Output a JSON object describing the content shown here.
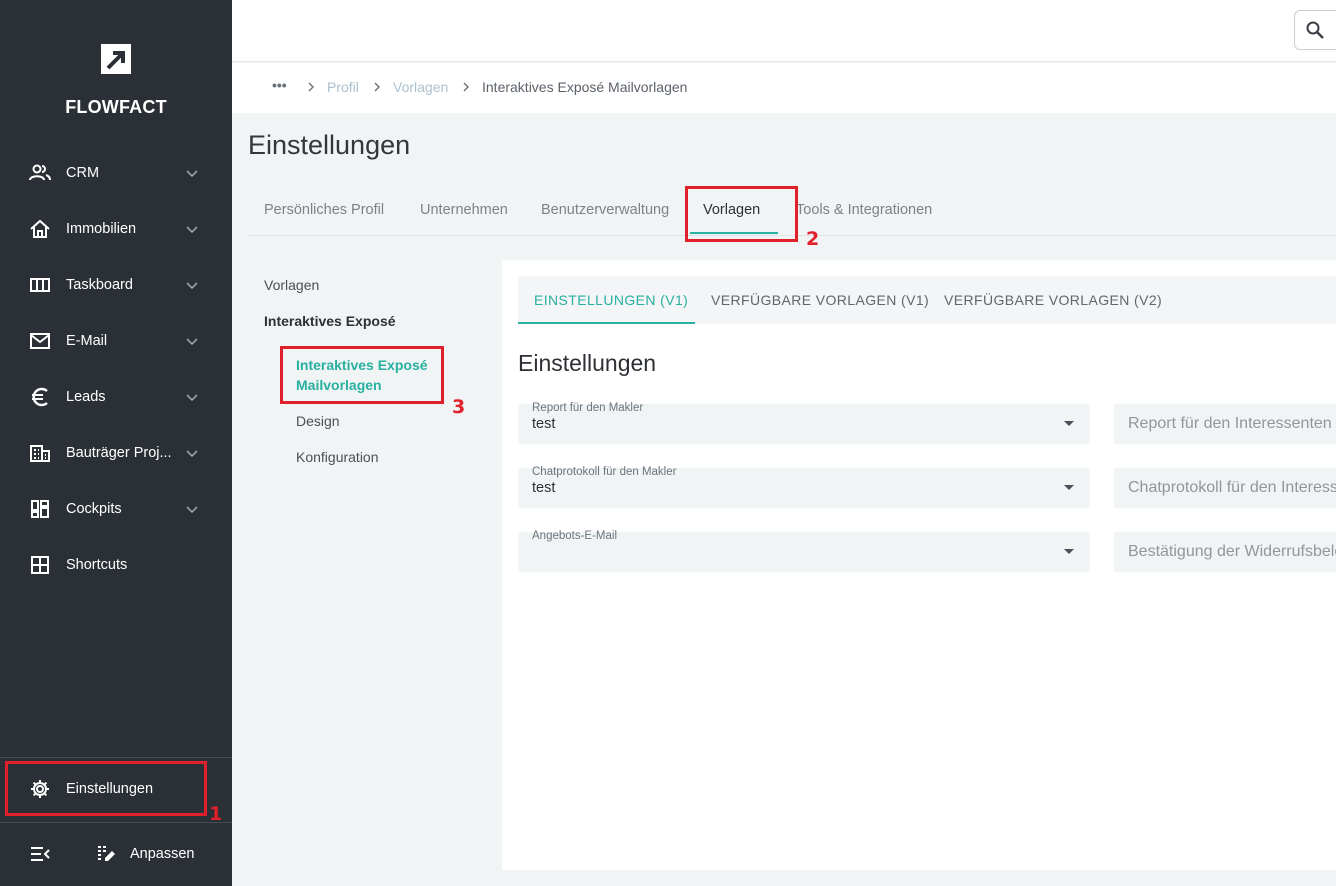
{
  "brand": {
    "name": "FLOWFACT"
  },
  "sidebar": {
    "items": [
      {
        "label": "CRM",
        "icon": "people-icon"
      },
      {
        "label": "Immobilien",
        "icon": "home-icon"
      },
      {
        "label": "Taskboard",
        "icon": "columns-icon"
      },
      {
        "label": "E-Mail",
        "icon": "mail-icon"
      },
      {
        "label": "Leads",
        "icon": "euro-icon"
      },
      {
        "label": "Bauträger Proj...",
        "icon": "building-icon"
      },
      {
        "label": "Cockpits",
        "icon": "dashboard-icon"
      },
      {
        "label": "Shortcuts",
        "icon": "grid-icon"
      }
    ],
    "settings_label": "Einstellungen",
    "customize_label": "Anpassen"
  },
  "breadcrumb": {
    "more": "•••",
    "items": [
      "Profil",
      "Vorlagen",
      "Interaktives Exposé Mailvorlagen"
    ]
  },
  "page": {
    "title": "Einstellungen",
    "tabs": [
      "Persönliches Profil",
      "Unternehmen",
      "Benutzerverwaltung",
      "Vorlagen",
      "Tools & Integrationen"
    ],
    "active_tab": "Vorlagen"
  },
  "subnav": {
    "items": [
      "Vorlagen",
      "Interaktives Exposé",
      "Interaktives Exposé",
      "Mailvorlagen",
      "Design",
      "Konfiguration"
    ]
  },
  "content": {
    "tabs": [
      "EINSTELLUNGEN (V1)",
      "VERFÜGBARE VORLAGEN (V1)",
      "VERFÜGBARE VORLAGEN (V2)"
    ],
    "section_title": "Einstellungen",
    "fields": [
      {
        "label": "Report für den Makler",
        "value": "test"
      },
      {
        "label": "Chatprotokoll für den Makler",
        "value": "test"
      },
      {
        "label": "Angebots-E-Mail",
        "value": ""
      }
    ],
    "right_fields": [
      "Report für den Interessenten",
      "Chatprotokoll für den Interessenten",
      "Bestätigung der Widerrufsbelehrung"
    ]
  },
  "annotations": [
    "1",
    "2",
    "3"
  ],
  "colors": {
    "accent": "#28b0a0",
    "sidebar": "#2b3036",
    "annotation": "#e0202b"
  }
}
